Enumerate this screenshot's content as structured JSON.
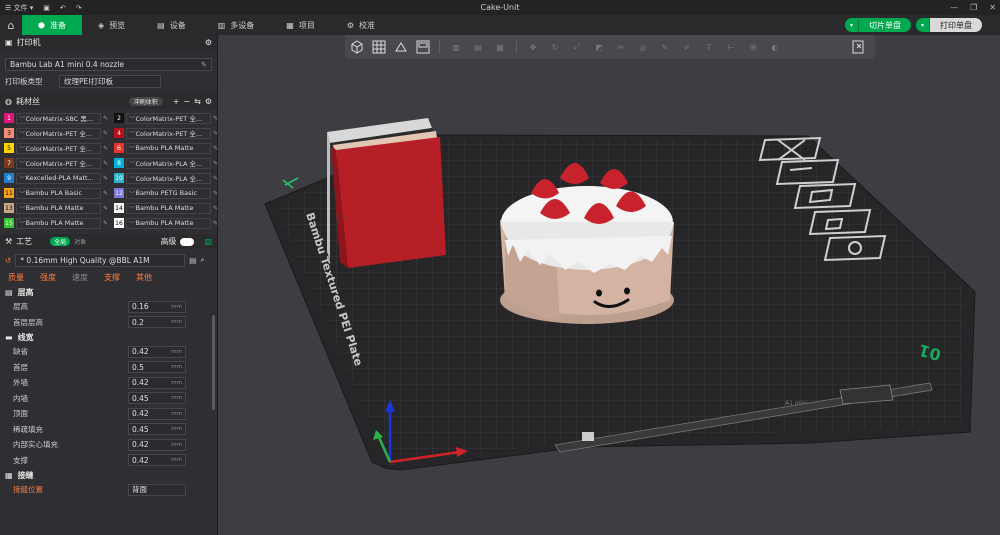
{
  "titlebar": {
    "file_menu": "文件",
    "title": "Cake-Unit"
  },
  "tabs": [
    {
      "label": "准备"
    },
    {
      "label": "预览"
    },
    {
      "label": "设备"
    },
    {
      "label": "多设备"
    },
    {
      "label": "项目"
    },
    {
      "label": "校准"
    }
  ],
  "actions": {
    "slice": "切片单盘",
    "print": "打印单盘"
  },
  "printer": {
    "section_title": "打印机",
    "name": "Bambu Lab A1 mini 0.4 nozzle",
    "plate_type_label": "打印板类型",
    "plate_type_value": "纹理PEI打印板"
  },
  "filament": {
    "section_title": "耗材丝",
    "flush_label": "冲刷体积",
    "items": [
      {
        "num": "1",
        "name": "ColorMatrix-SBC 黑...",
        "color": "#e0167a"
      },
      {
        "num": "2",
        "name": "ColorMatrix-PET 全...",
        "color": "#111111"
      },
      {
        "num": "3",
        "name": "ColorMatrix-PET 全...",
        "color": "#f08d7a"
      },
      {
        "num": "4",
        "name": "ColorMatrix-PET 全...",
        "color": "#b5121b"
      },
      {
        "num": "5",
        "name": "ColorMatrix-PET 全...",
        "color": "#ffd400"
      },
      {
        "num": "6",
        "name": "Bambu PLA Matte",
        "color": "#e5352c"
      },
      {
        "num": "7",
        "name": "ColorMatrix-PET 全...",
        "color": "#7a3a1e"
      },
      {
        "num": "8",
        "name": "ColorMatrix-PLA 全...",
        "color": "#00b4d8"
      },
      {
        "num": "9",
        "name": "Kexcelled-PLA Matt...",
        "color": "#1e7fd0"
      },
      {
        "num": "10",
        "name": "ColorMatrix-PLA 全...",
        "color": "#2ab3c9"
      },
      {
        "num": "11",
        "name": "Bambu PLA Basic",
        "color": "#f7a21b"
      },
      {
        "num": "12",
        "name": "Bambu PETG Basic",
        "color": "#7a79d6"
      },
      {
        "num": "13",
        "name": "Bambu PLA Matte",
        "color": "#c9a98a"
      },
      {
        "num": "14",
        "name": "Bambu PLA Matte",
        "color": "#f4f4f4"
      },
      {
        "num": "15",
        "name": "Bambu PLA Matte",
        "color": "#34c433"
      },
      {
        "num": "16",
        "name": "Bambu PLA Matte",
        "color": "#ffffff"
      }
    ]
  },
  "process": {
    "section_title": "工艺",
    "global_badge": "全局",
    "object_label": "对象",
    "advanced_label": "高级",
    "preset": "* 0.16mm High Quality @BBL A1M",
    "subtabs": [
      "质量",
      "强度",
      "速度",
      "支撑",
      "其他"
    ],
    "groups": [
      {
        "title": "层高",
        "rows": [
          {
            "label": "层高",
            "value": "0.16",
            "unit": "mm"
          },
          {
            "label": "首层层高",
            "value": "0.2",
            "unit": "mm"
          }
        ]
      },
      {
        "title": "线宽",
        "rows": [
          {
            "label": "缺省",
            "value": "0.42",
            "unit": "mm"
          },
          {
            "label": "首层",
            "value": "0.5",
            "unit": "mm"
          },
          {
            "label": "外墙",
            "value": "0.42",
            "unit": "mm"
          },
          {
            "label": "内墙",
            "value": "0.45",
            "unit": "mm"
          },
          {
            "label": "顶面",
            "value": "0.42",
            "unit": "mm"
          },
          {
            "label": "稀疏填充",
            "value": "0.45",
            "unit": "mm"
          },
          {
            "label": "内部实心填充",
            "value": "0.42",
            "unit": "mm"
          },
          {
            "label": "支撑",
            "value": "0.42",
            "unit": "mm"
          }
        ]
      },
      {
        "title": "接缝",
        "rows": [
          {
            "label": "接缝位置",
            "value": "背面",
            "unit": ""
          }
        ]
      }
    ]
  },
  "plate": {
    "brand_text": "Bambu Textured PEI Plate",
    "plate_number": "01",
    "model_id": "A1 mini"
  },
  "colors": {
    "accent": "#00a94f",
    "warn": "#ff7a3d",
    "sidebar": "#2f2f33",
    "viewport": "#3d3d42"
  }
}
